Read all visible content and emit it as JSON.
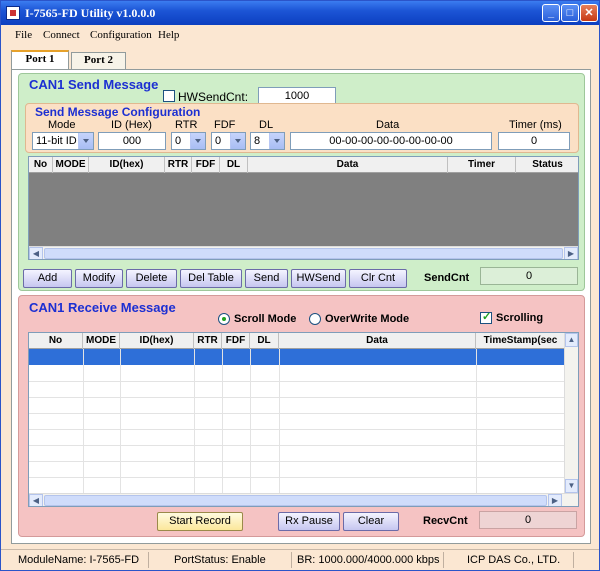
{
  "window": {
    "title": "I-7565-FD Utility v1.0.0.0"
  },
  "menu": [
    "File",
    "Connect",
    "Configuration",
    "Help"
  ],
  "tabs": [
    "Port 1",
    "Port 2"
  ],
  "send": {
    "title": "CAN1 Send Message",
    "hwsendcnt_label": "HWSendCnt:",
    "hwsendcnt_value": "1000",
    "config_title": "Send Message Configuration",
    "labels": {
      "mode": "Mode",
      "id": "ID (Hex)",
      "rtr": "RTR",
      "fdf": "FDF",
      "dl": "DL",
      "data": "Data",
      "timer": "Timer (ms)"
    },
    "values": {
      "mode": "11-bit ID",
      "id": "000",
      "rtr": "0",
      "fdf": "0",
      "dl": "8",
      "data": "00-00-00-00-00-00-00-00",
      "timer": "0"
    },
    "columns": [
      "No",
      "MODE",
      "ID(hex)",
      "RTR",
      "FDF",
      "DL",
      "Data",
      "Timer",
      "Status"
    ],
    "buttons": [
      "Add",
      "Modify",
      "Delete",
      "Del Table",
      "Send",
      "HWSend",
      "Clr Cnt"
    ],
    "sendcnt_label": "SendCnt",
    "sendcnt_value": "0"
  },
  "recv": {
    "title": "CAN1 Receive Message",
    "scroll_mode": "Scroll Mode",
    "overwrite_mode": "OverWrite Mode",
    "scrolling": "Scrolling",
    "columns": [
      "No",
      "MODE",
      "ID(hex)",
      "RTR",
      "FDF",
      "DL",
      "Data",
      "TimeStamp(sec"
    ],
    "start_record": "Start Record",
    "rx_pause": "Rx Pause",
    "clear": "Clear",
    "recvcnt_label": "RecvCnt",
    "recvcnt_value": "0"
  },
  "status": {
    "module": "ModuleName: I-7565-FD",
    "port": "PortStatus: Enable",
    "br": "BR: 1000.000/4000.000 kbps",
    "company": "ICP DAS Co., LTD."
  },
  "colors": {
    "title_accent": "#1c2fd2",
    "send_panel": "#cfeec9",
    "recv_panel": "#f5c3c3",
    "selected_row": "#2e6fd8"
  }
}
